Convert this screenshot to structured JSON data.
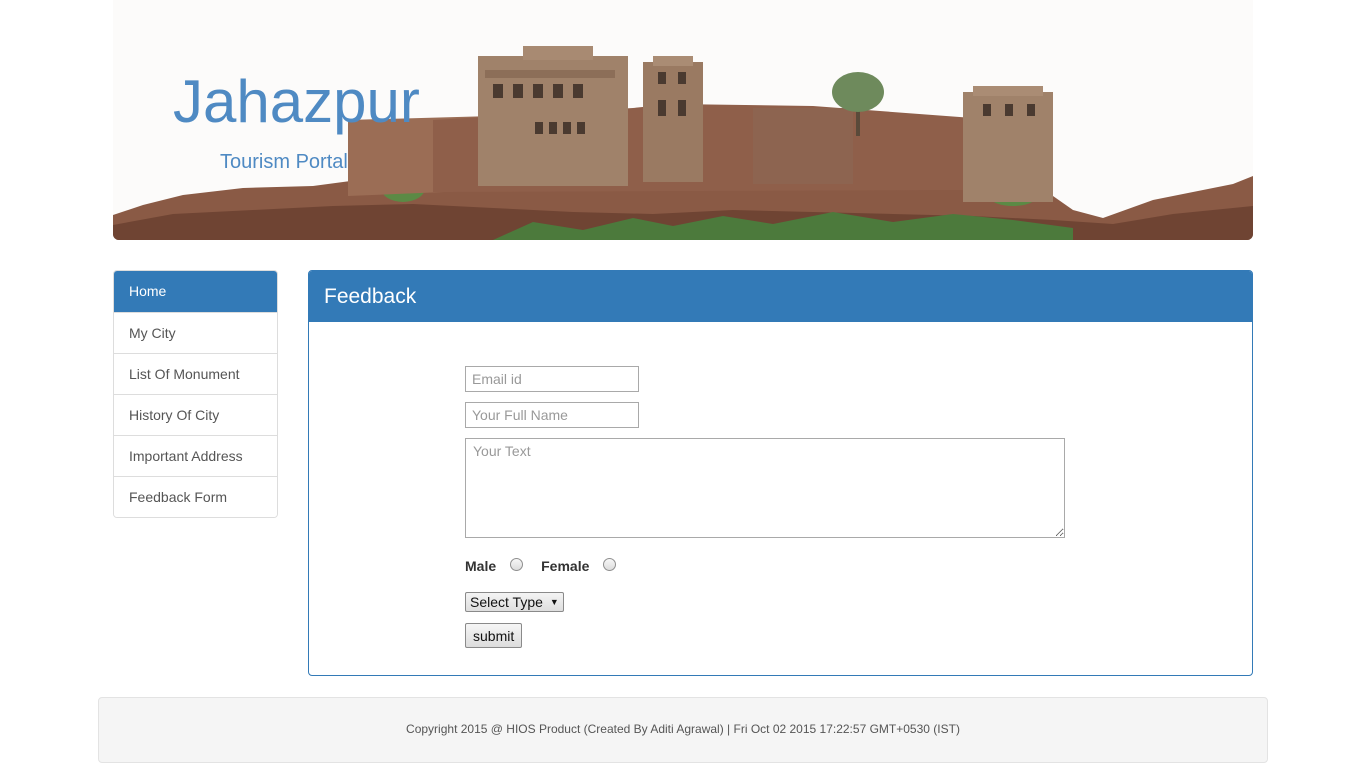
{
  "header": {
    "title": "Jahazpur",
    "subtitle": "Tourism Portal",
    "banner_image": "fort-landscape"
  },
  "sidebar": {
    "items": [
      {
        "label": "Home",
        "active": true
      },
      {
        "label": "My City",
        "active": false
      },
      {
        "label": "List Of Monument",
        "active": false
      },
      {
        "label": "History Of City",
        "active": false
      },
      {
        "label": "Important Address",
        "active": false
      },
      {
        "label": "Feedback Form",
        "active": false
      }
    ]
  },
  "feedback": {
    "heading": "Feedback",
    "email_placeholder": "Email id",
    "email_value": "",
    "name_placeholder": "Your Full Name",
    "name_value": "",
    "text_placeholder": "Your Text",
    "text_value": "",
    "gender_male": "Male",
    "gender_female": "Female",
    "type_selected": "Select Type",
    "submit_label": "submit"
  },
  "footer": {
    "text": "Copyright 2015 @ HIOS Product (Created By Aditi Agrawal) | Fri Oct 02 2015 17:22:57 GMT+0530 (IST)"
  },
  "colors": {
    "primary": "#337ab7",
    "title": "#4f8ac3",
    "footer_bg": "#f5f5f5"
  }
}
